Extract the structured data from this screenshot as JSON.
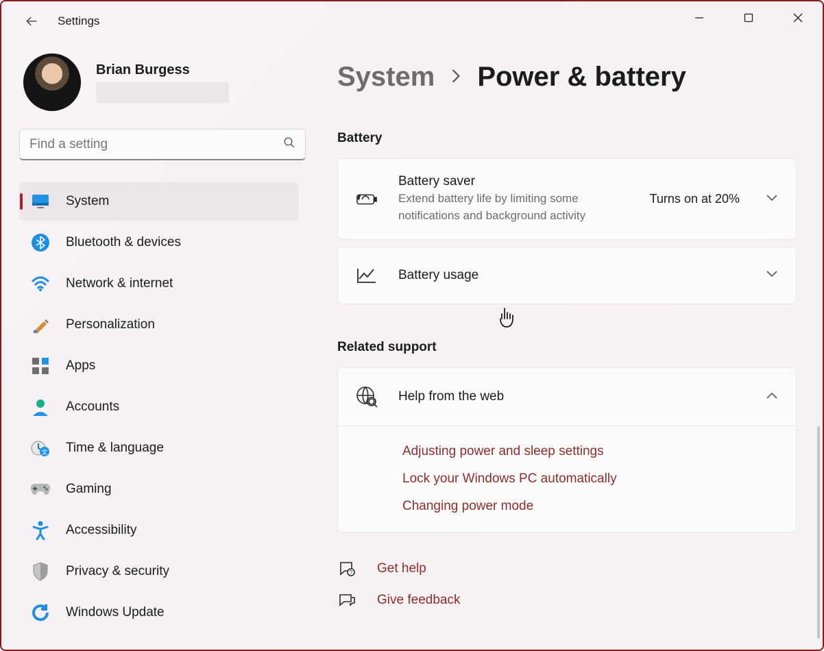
{
  "window": {
    "title": "Settings"
  },
  "user": {
    "name": "Brian Burgess"
  },
  "search": {
    "placeholder": "Find a setting"
  },
  "nav": {
    "system": "System",
    "bluetooth": "Bluetooth & devices",
    "network": "Network & internet",
    "personalization": "Personalization",
    "apps": "Apps",
    "accounts": "Accounts",
    "time": "Time & language",
    "gaming": "Gaming",
    "accessibility": "Accessibility",
    "privacy": "Privacy & security",
    "update": "Windows Update"
  },
  "breadcrumb": {
    "parent": "System",
    "current": "Power & battery"
  },
  "sections": {
    "battery_label": "Battery",
    "related_label": "Related support"
  },
  "battery_saver": {
    "title": "Battery saver",
    "desc": "Extend battery life by limiting some notifications and background activity",
    "status": "Turns on at 20%"
  },
  "battery_usage": {
    "title": "Battery usage"
  },
  "help": {
    "title": "Help from the web",
    "links": {
      "a": "Adjusting power and sleep settings",
      "b": "Lock your Windows PC automatically",
      "c": "Changing power mode"
    }
  },
  "footer": {
    "get_help": "Get help",
    "feedback": "Give feedback"
  }
}
